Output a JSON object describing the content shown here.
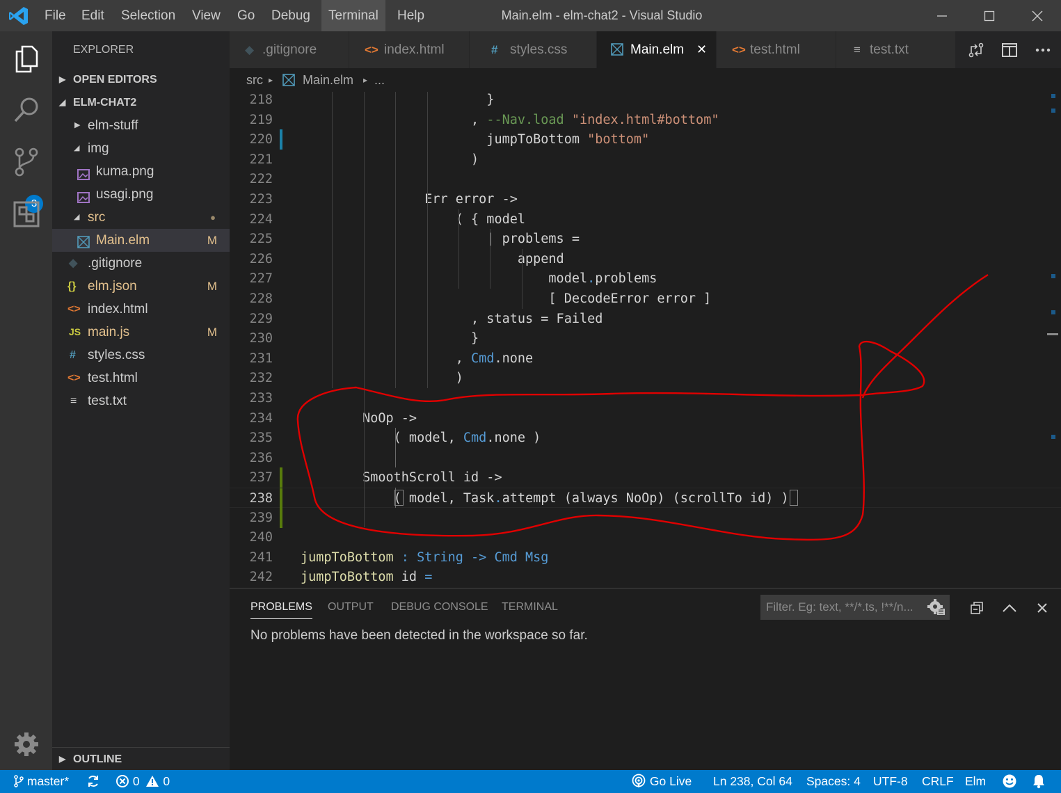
{
  "window": {
    "title": "Main.elm - elm-chat2 - Visual Studio Code"
  },
  "menu": [
    "File",
    "Edit",
    "Selection",
    "View",
    "Go",
    "Debug",
    "Terminal",
    "Help"
  ],
  "activity": {
    "scm_badge": "3"
  },
  "sidebar": {
    "title": "EXPLORER",
    "open_editors": "OPEN EDITORS",
    "project": "ELM-CHAT2",
    "outline": "OUTLINE",
    "tree": [
      {
        "name": "elm-stuff",
        "status": ""
      },
      {
        "name": "img",
        "status": ""
      },
      {
        "name": "kuma.png",
        "status": ""
      },
      {
        "name": "usagi.png",
        "status": ""
      },
      {
        "name": "src",
        "status": "●"
      },
      {
        "name": "Main.elm",
        "status": "M"
      },
      {
        "name": ".gitignore",
        "status": ""
      },
      {
        "name": "elm.json",
        "status": "M"
      },
      {
        "name": "index.html",
        "status": ""
      },
      {
        "name": "main.js",
        "status": "M"
      },
      {
        "name": "styles.css",
        "status": ""
      },
      {
        "name": "test.html",
        "status": ""
      },
      {
        "name": "test.txt",
        "status": ""
      }
    ]
  },
  "tabs": [
    {
      "label": ".gitignore"
    },
    {
      "label": "index.html"
    },
    {
      "label": "styles.css"
    },
    {
      "label": "Main.elm"
    },
    {
      "label": "test.html"
    },
    {
      "label": "test.txt"
    }
  ],
  "breadcrumb": {
    "folder": "src",
    "file": "Main.elm",
    "more": "..."
  },
  "editor": {
    "lines": [
      {
        "n": "218",
        "t": "                        }"
      },
      {
        "n": "219",
        "t": "                      , --Nav.load \"index.html#bottom\""
      },
      {
        "n": "220",
        "t": "                        jumpToBottom \"bottom\""
      },
      {
        "n": "221",
        "t": "                      )"
      },
      {
        "n": "222",
        "t": ""
      },
      {
        "n": "223",
        "t": "                Err error ->"
      },
      {
        "n": "224",
        "t": "                    ( { model"
      },
      {
        "n": "225",
        "t": "                        | problems ="
      },
      {
        "n": "226",
        "t": "                            append"
      },
      {
        "n": "227",
        "t": "                                model.problems"
      },
      {
        "n": "228",
        "t": "                                [ DecodeError error ]"
      },
      {
        "n": "229",
        "t": "                      , status = Failed"
      },
      {
        "n": "230",
        "t": "                      }"
      },
      {
        "n": "231",
        "t": "                    , Cmd.none"
      },
      {
        "n": "232",
        "t": "                    )"
      },
      {
        "n": "233",
        "t": ""
      },
      {
        "n": "234",
        "t": "        NoOp ->"
      },
      {
        "n": "235",
        "t": "            ( model, Cmd.none )"
      },
      {
        "n": "236",
        "t": ""
      },
      {
        "n": "237",
        "t": "        SmoothScroll id ->"
      },
      {
        "n": "238",
        "t": "            ( model, Task.attempt (always NoOp) (scrollTo id) )"
      },
      {
        "n": "239",
        "t": ""
      },
      {
        "n": "240",
        "t": ""
      },
      {
        "n": "241",
        "t": "jumpToBottom : String -> Cmd Msg"
      },
      {
        "n": "242",
        "t": "jumpToBottom id ="
      }
    ]
  },
  "panel": {
    "tabs": [
      "PROBLEMS",
      "OUTPUT",
      "DEBUG CONSOLE",
      "TERMINAL"
    ],
    "filter_placeholder": "Filter. Eg: text, **/*.ts, !**/n...",
    "message": "No problems have been detected in the workspace so far."
  },
  "status": {
    "branch": "master*",
    "errors": "0",
    "warnings": "0",
    "golive": "Go Live",
    "position": "Ln 238, Col 64",
    "spaces": "Spaces: 4",
    "encoding": "UTF-8",
    "eol": "CRLF",
    "language": "Elm"
  },
  "colors": {
    "accent": "#007acc",
    "annotation": "#e00000"
  }
}
